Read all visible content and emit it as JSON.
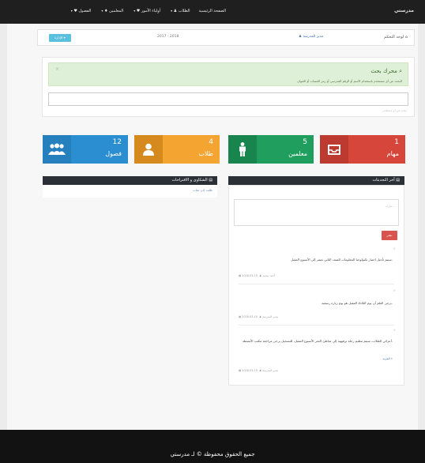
{
  "topbar": {
    "brand": "مدرستي",
    "nav": [
      {
        "label": "الصفحة الرئيسية",
        "icon": "none",
        "caret": false
      },
      {
        "label": "الطلاب",
        "icon": "user-icon",
        "caret": true
      },
      {
        "label": "أولياء الأمور",
        "icon": "heart-icon",
        "caret": true
      },
      {
        "label": "المعلمين",
        "icon": "person-icon",
        "caret": true
      },
      {
        "label": "الفصول",
        "icon": "heart-icon",
        "caret": true
      }
    ]
  },
  "breadcrumb": {
    "home": "لوحة التحكم",
    "school": "مدير المدرسة",
    "year": "2017 - 2018",
    "manage_button": "الإدارة"
  },
  "search": {
    "title": "محرك بحث",
    "description": "البحث عن أي مستخدم باستخدام الاسم أو الرقم المدرسي أو رمز الحساب أو العنوان",
    "close": "×",
    "hint": "ابحث عن أي مستخدم"
  },
  "stats": [
    {
      "key": "tasks",
      "value": "1",
      "label": "مهام",
      "icon": "inbox-icon",
      "color": "#d7463b"
    },
    {
      "key": "teachers",
      "value": "5",
      "label": "معلمين",
      "icon": "person-icon",
      "color": "#1f9e5d"
    },
    {
      "key": "students",
      "value": "4",
      "label": "طلاب",
      "icon": "user-icon",
      "color": "#f3a431"
    },
    {
      "key": "classes",
      "value": "12",
      "label": "فصول",
      "icon": "group-icon",
      "color": "#2b8ed0"
    }
  ],
  "complaints": {
    "title": "الشكاوى و الاقتراحات",
    "link": "طلب إذن غياب"
  },
  "updates": {
    "title": "آخر التحديثات",
    "placeholder": "شارك...",
    "post_button": "نشر",
    "posts": [
      {
        "text": "سيتم تأجيل اختبار تكنولوجيا المعلومات للصف الثاني عشر إلى الأسبوع المقبل.",
        "author": "أحمد محمد",
        "date": "2018-03-10",
        "more": ""
      },
      {
        "text": "يرجى العلم أن يوم الثلاثاء المقبل هو يوم زيارة رسمية.",
        "author": "مدير المدرسة",
        "date": "2018-03-10",
        "more": ""
      },
      {
        "text": "أعزائي الطلاب، سيتم تنظيم رحلة ترفيهية إلى شاطئ البحر الأسبوع المقبل، للتسجيل يرجى مراجعة مكتب الأنشطة.",
        "author": "مدير المدرسة",
        "date": "2018-03-10",
        "more": "المزيد"
      }
    ]
  },
  "footer": {
    "text": "جميع الحقوق محفوظة © لـ مدرستي"
  }
}
